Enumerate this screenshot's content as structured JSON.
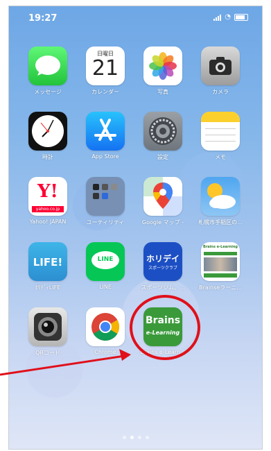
{
  "status_bar": {
    "time": "19:27"
  },
  "apps": [
    {
      "id": "messages",
      "label": "メッセージ",
      "icon": "speech-bubble-icon"
    },
    {
      "id": "calendar",
      "label": "カレンダー",
      "icon": "calendar-icon",
      "weekday": "日曜日",
      "day": "21"
    },
    {
      "id": "photos",
      "label": "写真",
      "icon": "photos-flower-icon"
    },
    {
      "id": "camera",
      "label": "カメラ",
      "icon": "camera-icon"
    },
    {
      "id": "clock",
      "label": "時計",
      "icon": "clock-icon"
    },
    {
      "id": "appstore",
      "label": "App Store",
      "icon": "app-store-icon"
    },
    {
      "id": "settings",
      "label": "設定",
      "icon": "gear-icon"
    },
    {
      "id": "notes",
      "label": "メモ",
      "icon": "notes-icon"
    },
    {
      "id": "yahoo",
      "label": "Yahoo! JAPAN",
      "icon": "yahoo-icon",
      "logo_text": "Y!",
      "logo_sub": "yahoo.co.jp"
    },
    {
      "id": "utility",
      "label": "ユーティリティ",
      "icon": "folder-icon"
    },
    {
      "id": "googlemaps",
      "label": "Google マップ -",
      "icon": "map-pin-icon"
    },
    {
      "id": "weather",
      "label": "札幌市手稲区の...",
      "icon": "weather-icon"
    },
    {
      "id": "life",
      "label": "ﾎﾘﾃﾞｨLIFE",
      "icon": "life-icon",
      "logo_text": "LIFE!"
    },
    {
      "id": "line",
      "label": "LINE",
      "icon": "line-icon",
      "logo_text": "LINE"
    },
    {
      "id": "holiday",
      "label": "スポーツジム、...",
      "icon": "holiday-icon",
      "logo_text": "ホリデイ",
      "logo_sub": "スポーツクラブ"
    },
    {
      "id": "brainse",
      "label": "Brainseラーニ...",
      "icon": "brains-web-icon",
      "logo_text": "Brains e-Learning"
    },
    {
      "id": "qr",
      "label": "QRコード",
      "icon": "qr-camera-icon"
    },
    {
      "id": "chrome",
      "label": "Chrome",
      "icon": "chrome-icon"
    },
    {
      "id": "brains",
      "label": "Brains e-Learn...",
      "icon": "brains-elearning-icon",
      "logo_text": "Brains",
      "logo_sub": "e-Learning"
    }
  ],
  "colors": {
    "highlight": "#e0101a",
    "brains_green": "#3a9a3a",
    "line_green": "#06c755"
  },
  "page_dots": {
    "count": 4,
    "active": 1
  }
}
